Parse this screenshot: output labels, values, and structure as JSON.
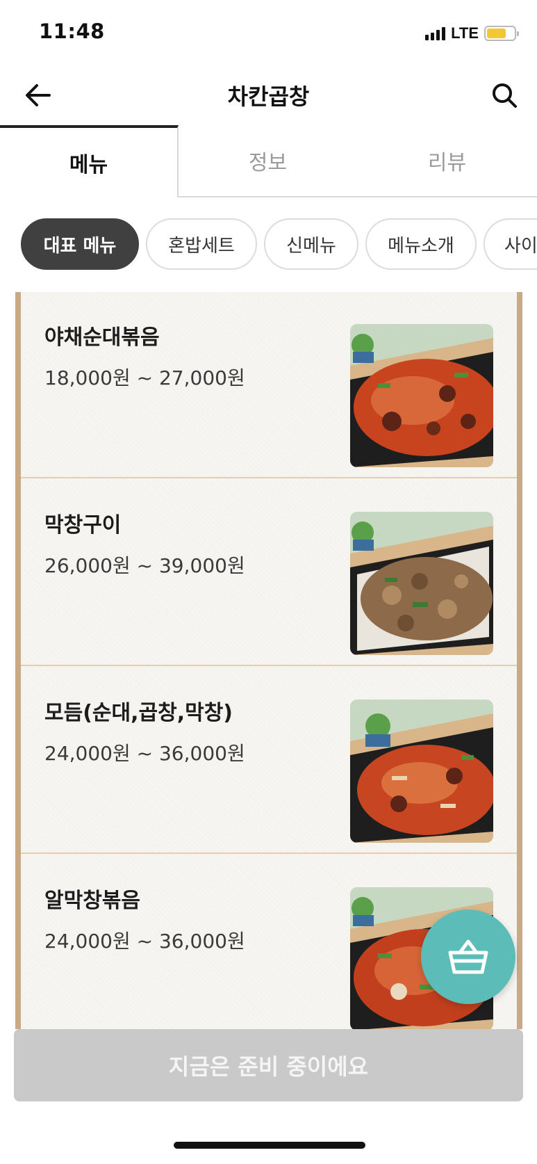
{
  "status_bar": {
    "time": "11:48",
    "network": "LTE"
  },
  "header": {
    "title": "차칸곱창"
  },
  "tabs": [
    {
      "label": "메뉴",
      "active": true
    },
    {
      "label": "정보",
      "active": false
    },
    {
      "label": "리뷰",
      "active": false
    }
  ],
  "categories": [
    {
      "label": "대표 메뉴",
      "active": true
    },
    {
      "label": "혼밥세트",
      "active": false
    },
    {
      "label": "신메뉴",
      "active": false
    },
    {
      "label": "메뉴소개",
      "active": false
    },
    {
      "label": "사이",
      "active": false
    }
  ],
  "menu_items": [
    {
      "name": "야채순대볶음",
      "price": "18,000원 ~ 27,000원"
    },
    {
      "name": "막창구이",
      "price": "26,000원 ~ 39,000원"
    },
    {
      "name": "모듬(순대,곱창,막창)",
      "price": "24,000원 ~ 36,000원"
    },
    {
      "name": "알막창볶음",
      "price": "24,000원 ~ 36,000원"
    }
  ],
  "order_bar": {
    "label": "지금은 준비 중이에요"
  },
  "colors": {
    "accent_teal": "#5bbcb8",
    "chip_active": "#404040",
    "frame_wood": "#c9aa86",
    "battery_yellow": "#f4c534",
    "disabled_bar": "#c9c9c9"
  }
}
